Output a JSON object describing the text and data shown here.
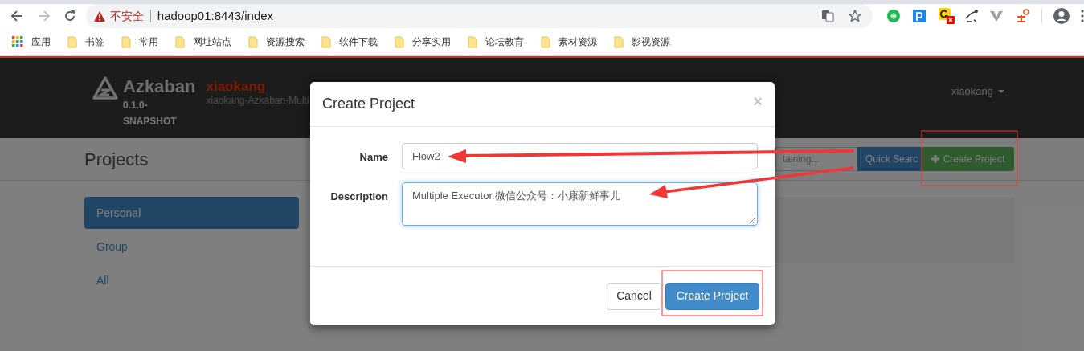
{
  "browser": {
    "address": {
      "security_label": "不安全",
      "url": "hadoop01:8443/index"
    },
    "bookmarks": [
      {
        "label": "应用",
        "kind": "apps"
      },
      {
        "label": "书签",
        "kind": "folder"
      },
      {
        "label": "常用",
        "kind": "folder"
      },
      {
        "label": "网址站点",
        "kind": "folder"
      },
      {
        "label": "资源搜索",
        "kind": "folder"
      },
      {
        "label": "软件下载",
        "kind": "folder"
      },
      {
        "label": "分享实用",
        "kind": "folder"
      },
      {
        "label": "论坛教育",
        "kind": "folder"
      },
      {
        "label": "素材资源",
        "kind": "folder"
      },
      {
        "label": "影视资源",
        "kind": "folder"
      }
    ]
  },
  "header": {
    "brand": "Azkaban",
    "version": "0.1.0-SNAPSHOT",
    "env_name": "xiaokang",
    "env_description": "xiaokang-Azkaban-Multi",
    "user_menu": "xiaokang"
  },
  "page_title": "Projects",
  "search": {
    "placeholder": "taining..."
  },
  "toolbar_buttons": [
    {
      "label": "Quick Searc",
      "kind": "search"
    },
    {
      "label": "Create Project",
      "kind": "create"
    }
  ],
  "nav": [
    {
      "label": "Personal",
      "selected": true
    },
    {
      "label": "Group",
      "selected": false
    },
    {
      "label": "All",
      "selected": false
    }
  ],
  "modal": {
    "title": "Create Project",
    "close": "×",
    "fields": [
      {
        "label": "Name",
        "value": "Flow2",
        "kind": "input"
      },
      {
        "label": "Description",
        "value": "Multiple Executor.微信公众号：小康新鲜事儿",
        "kind": "textarea"
      }
    ],
    "buttons": [
      {
        "label": "Cancel",
        "kind": "default"
      },
      {
        "label": "Create Project",
        "kind": "primary"
      }
    ]
  }
}
